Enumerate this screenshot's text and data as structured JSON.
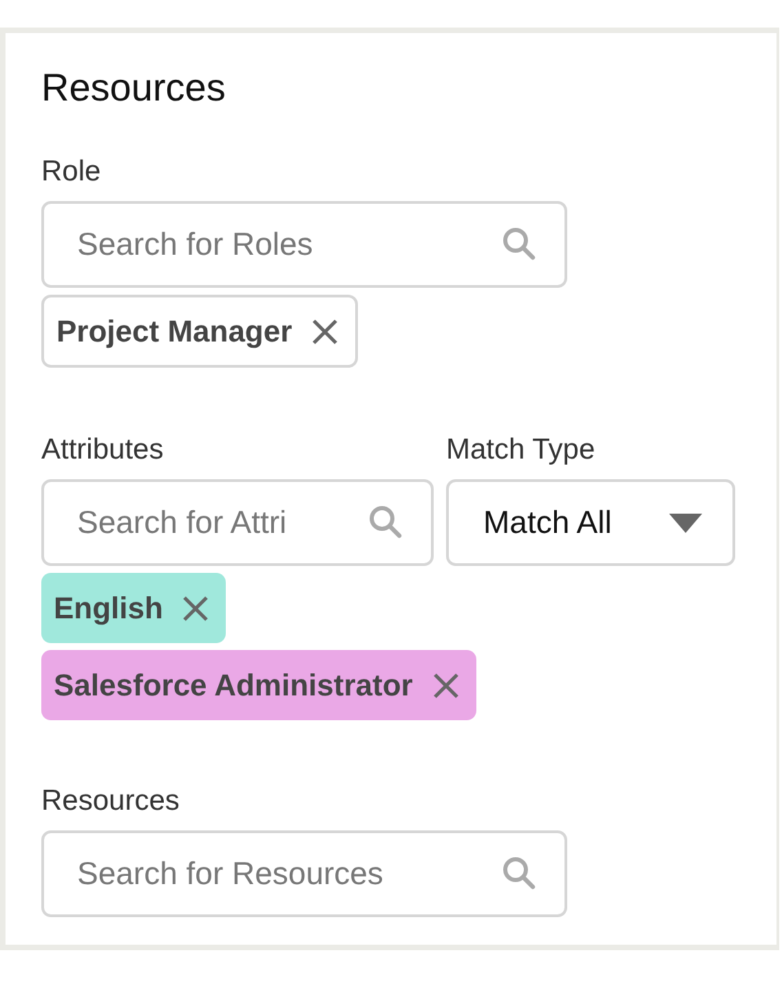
{
  "panel": {
    "title": "Resources"
  },
  "role": {
    "label": "Role",
    "placeholder": "Search for Roles",
    "tags": [
      {
        "label": "Project Manager"
      }
    ]
  },
  "attributes": {
    "label": "Attributes",
    "placeholder": "Search for Attri",
    "tags": [
      {
        "label": "English",
        "color": "#a0e8dc"
      },
      {
        "label": "Salesforce Administrator",
        "color": "#eaa8e6"
      }
    ]
  },
  "match_type": {
    "label": "Match Type",
    "value": "Match All"
  },
  "resources": {
    "label": "Resources",
    "placeholder": "Search for Resources"
  }
}
